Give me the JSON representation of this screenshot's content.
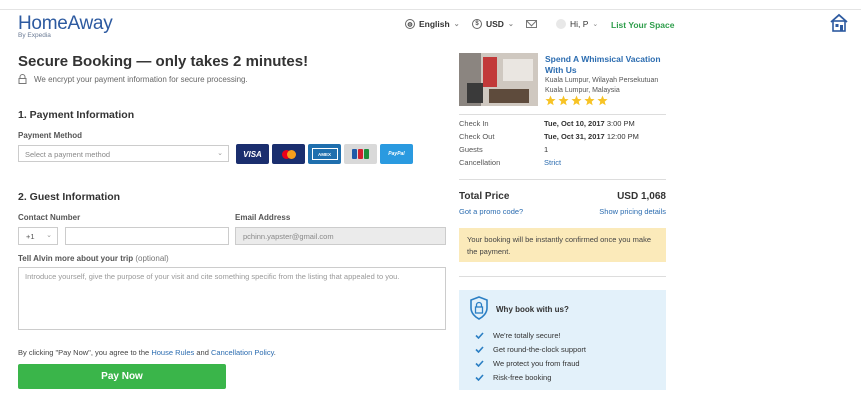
{
  "header": {
    "logo": "HomeAway",
    "logo_sub": "By Expedia",
    "language": "English",
    "currency": "USD",
    "user": "Hi, P",
    "list_space": "List Your Space"
  },
  "booking": {
    "title": "Secure Booking — only takes 2 minutes!",
    "secure_note": "We encrypt your payment information for secure processing.",
    "payment": {
      "heading": "1. Payment Information",
      "method_label": "Payment Method",
      "method_placeholder": "Select a payment method",
      "cards": [
        "VISA",
        "MasterCard",
        "AMERICAN EXPRESS",
        "JCB",
        "PayPal"
      ]
    },
    "guest": {
      "heading": "2. Guest Information",
      "contact_label": "Contact Number",
      "country_code": "+1",
      "phone_value": "",
      "email_label": "Email Address",
      "email_value": "pchinn.yapster@gmail.com",
      "trip_label": "Tell Alvin more about your trip",
      "trip_optional": "(optional)",
      "trip_placeholder": "Introduce yourself, give the purpose of your visit and cite something specific from the listing that appealed to you."
    },
    "agreement": {
      "prefix": "By clicking \"Pay Now\", you agree to the",
      "house_rules": "House Rules",
      "and": "and",
      "cancellation": "Cancellation Policy",
      "suffix": "."
    },
    "pay_button": "Pay Now"
  },
  "summary": {
    "property_title": "Spend A Whimsical Vacation With Us",
    "location_line1": "Kuala Lumpur, Wilayah Persekutuan",
    "location_line2": "Kuala Lumpur, Malaysia",
    "rating": 5,
    "star_color": "#f7c325",
    "checkin_label": "Check In",
    "checkin_date": "Tue, Oct 10, 2017",
    "checkin_time": "3:00 PM",
    "checkout_label": "Check Out",
    "checkout_date": "Tue, Oct 31, 2017",
    "checkout_time": "12:00 PM",
    "guests_label": "Guests",
    "guests_value": "1",
    "cancellation_label": "Cancellation",
    "cancellation_value": "Strict",
    "total_label": "Total Price",
    "total_value": "USD 1,068",
    "promo": "Got a promo code?",
    "pricing_details": "Show pricing details",
    "notice": "Your booking will be instantly confirmed once you make the payment.",
    "why_heading": "Why book with us?",
    "why_items": [
      "We're totally secure!",
      "Get round-the-clock support",
      "We protect you from fraud",
      "Risk-free booking"
    ]
  },
  "colors": {
    "brand_blue": "#2d5aa0",
    "link": "#2b6cb0",
    "pay_green": "#3ab54a",
    "notice_bg": "#fbeaba",
    "why_bg": "#e3f1fa"
  }
}
